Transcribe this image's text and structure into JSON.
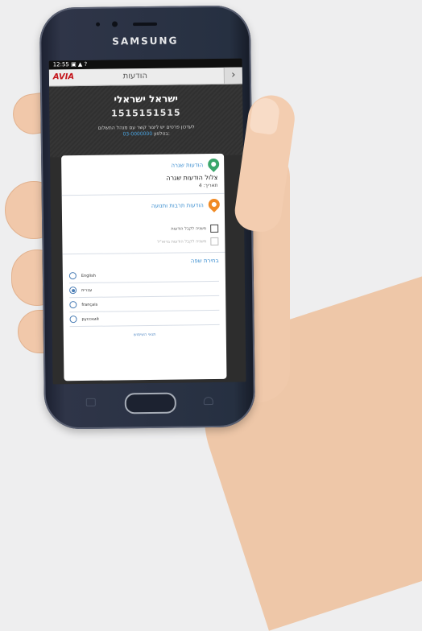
{
  "device": {
    "brand": "SAMSUNG"
  },
  "status_bar": {
    "text": "12:55 ▣ ▲ ?"
  },
  "app_bar": {
    "logo": "AVIA",
    "title": "הודעות",
    "back_icon": "chevron-right-icon"
  },
  "profile": {
    "name": "ישראל ישראלי",
    "number": "1515151515",
    "note_line1": "לעדכון פרטים יש ליצור קשר עם מנהל התשלום",
    "note_line2_prefix": "בטלפון:",
    "note_phone": "03-0000000"
  },
  "sections": {
    "alerts": {
      "title": "הודעות שגרה",
      "icon": "map-pin-icon",
      "color": "#3aa66b",
      "message_title": "צלול הודעות שגרה",
      "message_sub": "תאריך: 4"
    },
    "traffic": {
      "title": "הודעות תרבות ותנועה",
      "icon": "map-pin-icon",
      "color": "#f08a24",
      "options": [
        {
          "label": "משניה לקבל הודעות",
          "checked": false,
          "disabled": false
        },
        {
          "label": "משניה לקבל הודעות בדוא\"ל",
          "checked": false,
          "disabled": true
        }
      ]
    }
  },
  "language": {
    "title": "בחירת שפה",
    "options": [
      {
        "label": "English",
        "selected": false
      },
      {
        "label": "עברית",
        "selected": true
      },
      {
        "label": "français",
        "selected": false
      },
      {
        "label": "русский",
        "selected": false
      }
    ],
    "terms": "תנאי השימוש"
  }
}
